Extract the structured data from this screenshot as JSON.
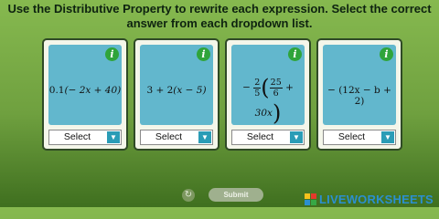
{
  "instructions": "Use the Distributive Property to rewrite each expression. Select the correct answer from each dropdown list.",
  "cards": [
    {
      "select_value": "Select"
    },
    {
      "select_value": "Select"
    },
    {
      "select_value": "Select"
    },
    {
      "select_value": "Select"
    }
  ],
  "expressions": {
    "e1_coef": "0.1",
    "e1_body": "(− 2x + 40)",
    "e2_a": "3 + 2",
    "e2_b": "(x − 5)",
    "e3_sign": "−",
    "e3_num": "2",
    "e3_den": "5",
    "e3_inner_num": "25",
    "e3_inner_den": "6",
    "e3_rest": "+ 30x",
    "e4": "− (12x − b + 2)"
  },
  "info_label": "i",
  "controls": {
    "submit_label": "Submit",
    "reset_icon": "reset-icon"
  },
  "branding": {
    "logo_text": "LIVEWORKSHEETS"
  },
  "colors": {
    "background": "#86b94f",
    "card_inner": "#62b7cd",
    "info": "#2fa43a",
    "select_arrow": "#2a9cb6",
    "logo": "#2b8fd0"
  }
}
